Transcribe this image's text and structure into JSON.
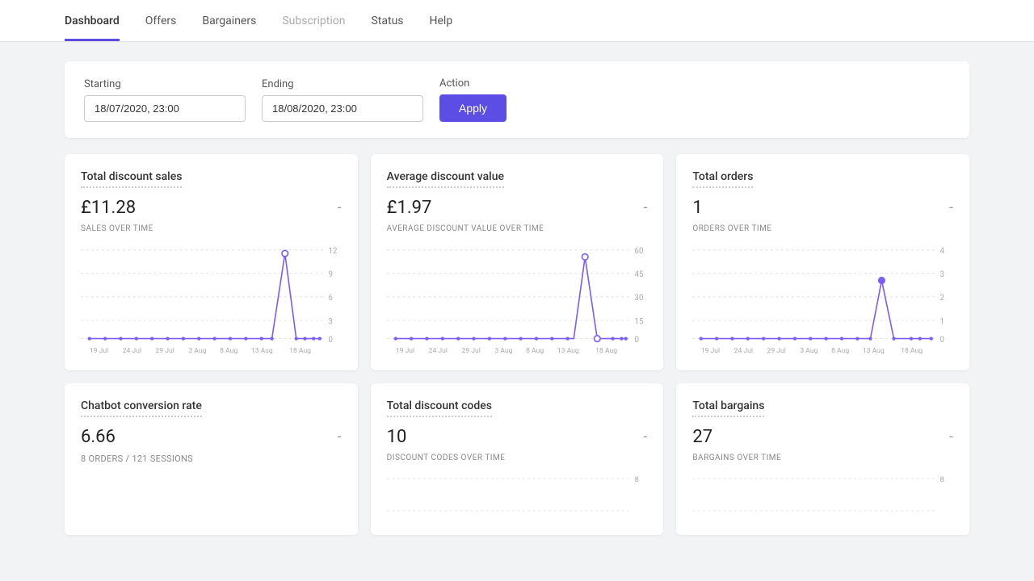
{
  "nav": {
    "tabs": [
      {
        "label": "Dashboard",
        "active": true,
        "disabled": false
      },
      {
        "label": "Offers",
        "active": false,
        "disabled": false
      },
      {
        "label": "Bargainers",
        "active": false,
        "disabled": false
      },
      {
        "label": "Subscription",
        "active": false,
        "disabled": true
      },
      {
        "label": "Status",
        "active": false,
        "disabled": false
      },
      {
        "label": "Help",
        "active": false,
        "disabled": false
      }
    ]
  },
  "filter": {
    "starting_label": "Starting",
    "ending_label": "Ending",
    "action_label": "Action",
    "starting_value": "18/07/2020, 23:00",
    "ending_value": "18/08/2020, 23:00",
    "apply_label": "Apply"
  },
  "cards": [
    {
      "title": "Total discount sales",
      "value": "£11.28",
      "subtitle": "SALES OVER TIME",
      "dash": "-",
      "chart_type": "spike_right",
      "y_labels": [
        "12",
        "9",
        "6",
        "3",
        "0"
      ],
      "x_labels": [
        "19 Jul",
        "24 Jul",
        "29 Jul",
        "3 Aug",
        "8 Aug",
        "13 Aug",
        "18 Aug"
      ]
    },
    {
      "title": "Average discount value",
      "value": "£1.97",
      "subtitle": "AVERAGE DISCOUNT VALUE OVER TIME",
      "dash": "-",
      "chart_type": "spike_right",
      "y_labels": [
        "60",
        "45",
        "30",
        "15",
        "0"
      ],
      "x_labels": [
        "19 Jul",
        "24 Jul",
        "29 Jul",
        "3 Aug",
        "8 Aug",
        "13 Aug",
        "18 Aug"
      ]
    },
    {
      "title": "Total orders",
      "value": "1",
      "subtitle": "ORDERS OVER TIME",
      "dash": "-",
      "chart_type": "spike_right_small",
      "y_labels": [
        "4",
        "3",
        "2",
        "1",
        "0"
      ],
      "x_labels": [
        "19 Jul",
        "24 Jul",
        "29 Jul",
        "3 Aug",
        "8 Aug",
        "13 Aug",
        "18 Aug"
      ]
    },
    {
      "title": "Chatbot conversion rate",
      "value": "6.66",
      "subtitle": "",
      "sub_info": "8 ORDERS / 121 SESSIONS",
      "dash": "-",
      "chart_type": "none",
      "y_labels": [],
      "x_labels": []
    },
    {
      "title": "Total discount codes",
      "value": "10",
      "subtitle": "DISCOUNT CODES OVER TIME",
      "dash": "-",
      "chart_type": "partial",
      "y_labels": [
        "8",
        ""
      ],
      "x_labels": []
    },
    {
      "title": "Total bargains",
      "value": "27",
      "subtitle": "BARGAINS OVER TIME",
      "dash": "-",
      "chart_type": "partial",
      "y_labels": [
        "8",
        ""
      ],
      "x_labels": []
    }
  ]
}
